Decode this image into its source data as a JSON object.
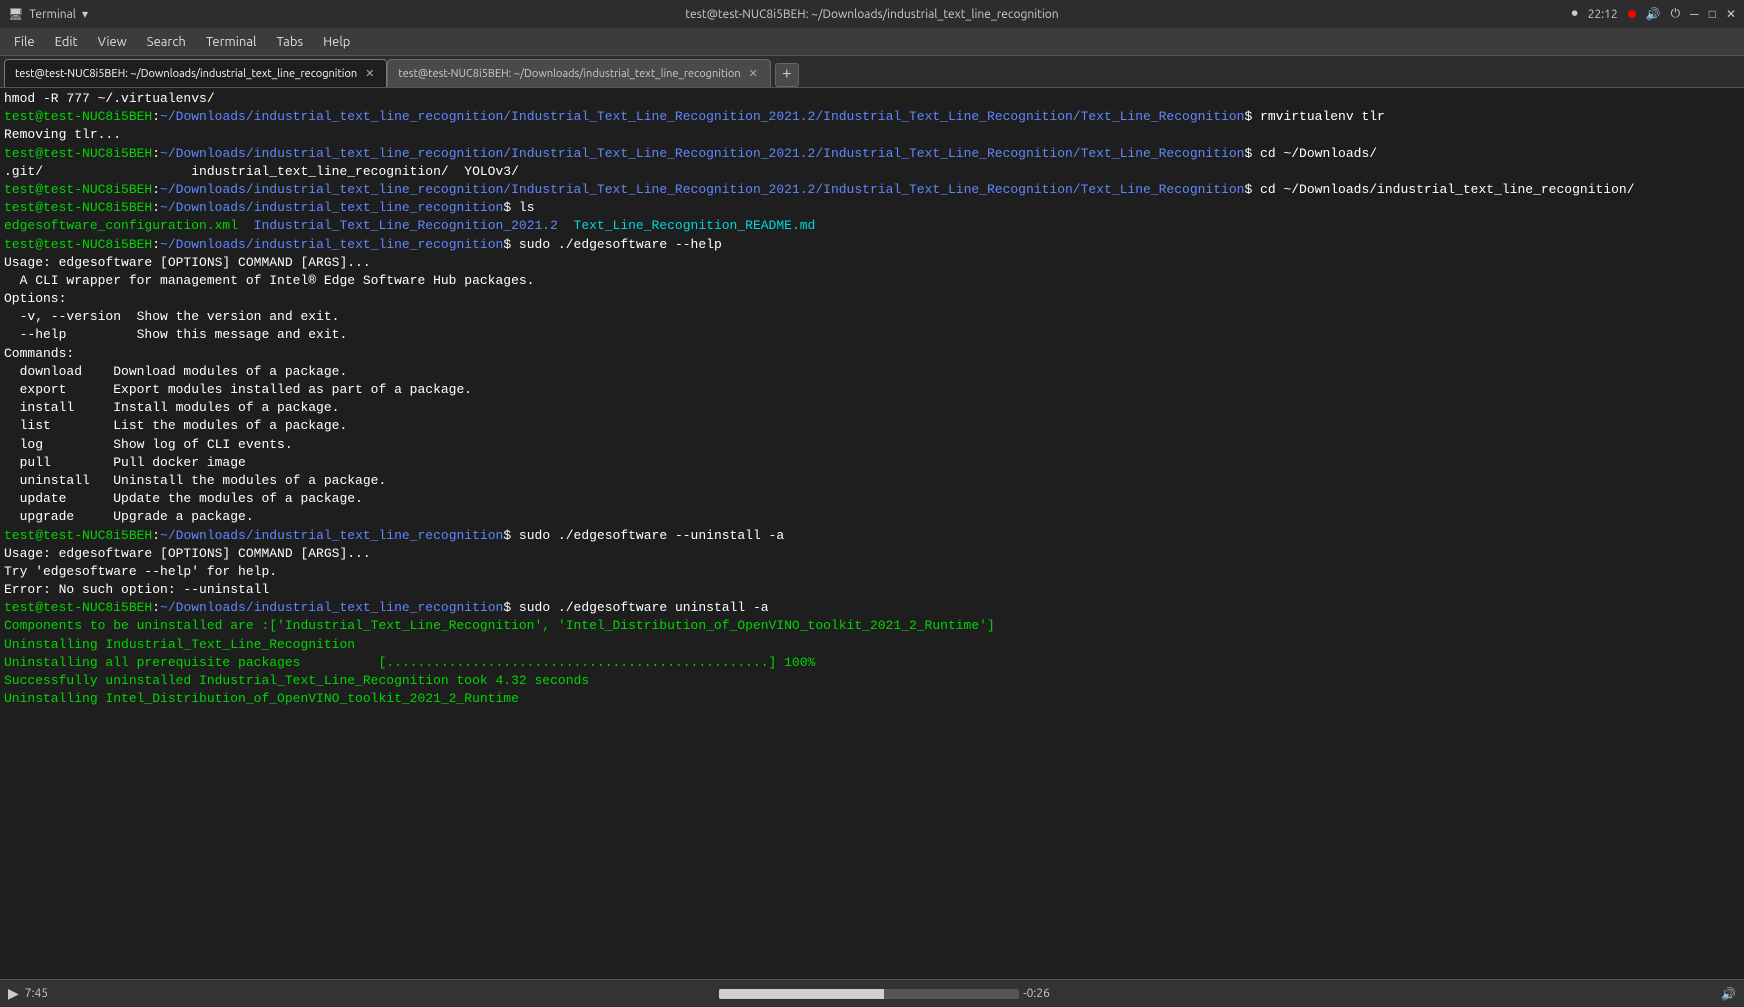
{
  "system_bar": {
    "app_name": "Terminal",
    "title": "test@test-NUC8i5BEH: ~/Downloads/industrial_text_line_recognition",
    "time": "22:12",
    "recording_dot": true
  },
  "menu_bar": {
    "items": [
      "File",
      "Edit",
      "View",
      "Search",
      "Terminal",
      "Tabs",
      "Help"
    ]
  },
  "tabs": [
    {
      "label": "test@test-NUC8i5BEH: ~/Downloads/industrial_text_line_recognition",
      "active": true
    },
    {
      "label": "test@test-NUC8i5BEH: ~/Downloads/industrial_text_line_recognition",
      "active": false
    }
  ],
  "terminal": {
    "lines": [
      {
        "type": "cmd_line",
        "prompt": "hmod -R 777 ~/.virtualenvs/"
      },
      {
        "type": "prompt_cmd",
        "prompt_text": "test@test-NUC8i5BEH:~/Downloads/industrial_text_line_recognition/Industrial_Text_Line_Recognition_2021.2/Industrial_Text_Line_Recognition/Text_Line_Recognition$",
        "cmd": " rmvirtualenv tlr"
      },
      {
        "type": "plain",
        "text": "Removing tlr..."
      },
      {
        "type": "prompt_cmd",
        "prompt_text": "test@test-NUC8i5BEH:~/Downloads/industrial_text_line_recognition/Industrial_Text_Line_Recognition_2021.2/Industrial_Text_Line_Recognition/Text_Line_Recognition$",
        "cmd": " cd ~/Downloads/"
      },
      {
        "type": "plain",
        "text": ".git/                   industrial_text_line_recognition/  YOLOv3/"
      },
      {
        "type": "prompt_cmd",
        "prompt_text": "test@test-NUC8i5BEH:~/Downloads/industrial_text_line_recognition/Industrial_Text_Line_Recognition_2021.2/Industrial_Text_Line_Recognition/Text_Line_Recognition$",
        "cmd": " cd ~/Downloads/industrial_text_line_recognition/"
      },
      {
        "type": "prompt_cmd",
        "prompt_text": "test@test-NUC8i5BEH:~/Downloads/industrial_text_line_recognition$",
        "cmd": " ls"
      },
      {
        "type": "ls_output",
        "files": [
          "edgesoftware_configuration.xml",
          "Industrial_Text_Line_Recognition_2021.2",
          "Text_Line_Recognition_README.md"
        ]
      },
      {
        "type": "prompt_cmd",
        "prompt_text": "test@test-NUC8i5BEH:~/Downloads/industrial_text_line_recognition$",
        "cmd": " sudo ./edgesoftware --help"
      },
      {
        "type": "plain",
        "text": "Usage: edgesoftware [OPTIONS] COMMAND [ARGS]..."
      },
      {
        "type": "plain",
        "text": ""
      },
      {
        "type": "plain",
        "text": "  A CLI wrapper for management of Intel® Edge Software Hub packages."
      },
      {
        "type": "plain",
        "text": ""
      },
      {
        "type": "plain",
        "text": "Options:"
      },
      {
        "type": "plain",
        "text": "  -v, --version  Show the version and exit."
      },
      {
        "type": "plain",
        "text": "  --help         Show this message and exit."
      },
      {
        "type": "plain",
        "text": ""
      },
      {
        "type": "plain",
        "text": "Commands:"
      },
      {
        "type": "plain",
        "text": "  download    Download modules of a package."
      },
      {
        "type": "plain",
        "text": "  export      Export modules installed as part of a package."
      },
      {
        "type": "plain",
        "text": "  install     Install modules of a package."
      },
      {
        "type": "plain",
        "text": "  list        List the modules of a package."
      },
      {
        "type": "plain",
        "text": "  log         Show log of CLI events."
      },
      {
        "type": "plain",
        "text": "  pull        Pull docker image"
      },
      {
        "type": "plain",
        "text": "  uninstall   Uninstall the modules of a package."
      },
      {
        "type": "plain",
        "text": "  update      Update the modules of a package."
      },
      {
        "type": "plain",
        "text": "  upgrade     Upgrade a package."
      },
      {
        "type": "prompt_cmd",
        "prompt_text": "test@test-NUC8i5BEH:~/Downloads/industrial_text_line_recognition$",
        "cmd": " sudo ./edgesoftware --uninstall -a"
      },
      {
        "type": "plain",
        "text": "Usage: edgesoftware [OPTIONS] COMMAND [ARGS]..."
      },
      {
        "type": "plain",
        "text": "Try 'edgesoftware --help' for help."
      },
      {
        "type": "plain",
        "text": ""
      },
      {
        "type": "plain",
        "text": "Error: No such option: --uninstall"
      },
      {
        "type": "prompt_cmd",
        "prompt_text": "test@test-NUC8i5BEH:~/Downloads/industrial_text_line_recognition$",
        "cmd": " sudo ./edgesoftware uninstall -a"
      },
      {
        "type": "green_line",
        "text": "Components to be uninstalled are :['Industrial_Text_Line_Recognition', 'Intel_Distribution_of_OpenVINO_toolkit_2021_2_Runtime']"
      },
      {
        "type": "green_line",
        "text": "Uninstalling Industrial_Text_Line_Recognition"
      },
      {
        "type": "progress_line",
        "label": "Uninstalling all prerequisite packages",
        "dots": "[.................................................] 100%"
      },
      {
        "type": "green_line",
        "text": "Successfully uninstalled Industrial_Text_Line_Recognition took 4.32 seconds"
      },
      {
        "type": "green_partial",
        "text": "Uninstalling Intel_Distribution_of_OpenVINO_toolkit_2021_2_Runtime"
      }
    ]
  },
  "status_bar": {
    "play_label": "▶",
    "time_display": "7:45",
    "progress_pct": 55,
    "time_remaining": "-0:26",
    "speaker_icon": "🔊"
  }
}
